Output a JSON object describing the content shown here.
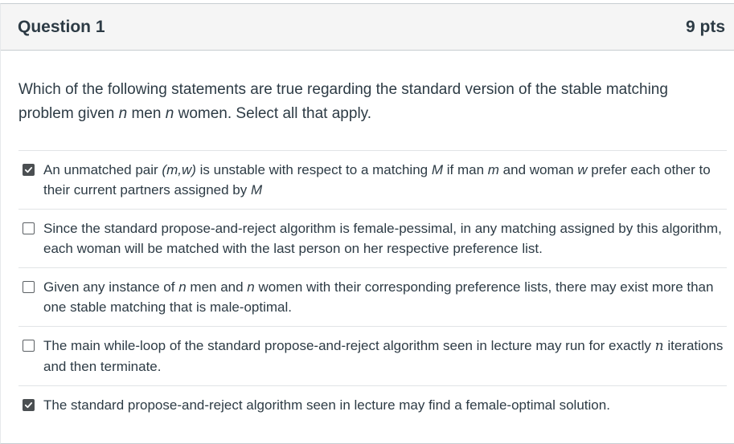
{
  "question": {
    "title": "Question 1",
    "points": "9 pts",
    "prompt": {
      "part1": "Which of the following statements are true regarding the standard version of the stable matching problem given ",
      "n1": "n",
      "part2": " men ",
      "n2": "n",
      "part3": " women. Select all that apply."
    }
  },
  "answers": [
    {
      "checked": true,
      "segments": [
        {
          "t": "An unmatched pair "
        },
        {
          "t": "(m,w)",
          "i": true
        },
        {
          "t": " is unstable with respect to a matching "
        },
        {
          "t": "M",
          "i": true
        },
        {
          "t": " if man "
        },
        {
          "t": "m",
          "i": true
        },
        {
          "t": " and woman "
        },
        {
          "t": "w",
          "i": true
        },
        {
          "t": " prefer each other to their current partners assigned by "
        },
        {
          "t": "M",
          "i": true
        }
      ]
    },
    {
      "checked": false,
      "segments": [
        {
          "t": "Since the standard propose-and-reject algorithm is female-pessimal, in any matching assigned by this algorithm, each woman will be matched with the last person on her respective preference list."
        }
      ]
    },
    {
      "checked": false,
      "segments": [
        {
          "t": "Given any instance of "
        },
        {
          "t": "n",
          "i": true
        },
        {
          "t": " men and "
        },
        {
          "t": "n",
          "i": true
        },
        {
          "t": " women with their corresponding preference lists, there may exist more than one stable matching that is male-optimal."
        }
      ]
    },
    {
      "checked": false,
      "segments": [
        {
          "t": "The main while-loop of the standard propose-and-reject algorithm seen in lecture may run for exactly "
        },
        {
          "t": "n",
          "m": true
        },
        {
          "t": " iterations and then terminate."
        }
      ]
    },
    {
      "checked": true,
      "segments": [
        {
          "t": "The standard propose-and-reject algorithm seen in lecture may find a female-optimal solution."
        }
      ]
    }
  ]
}
